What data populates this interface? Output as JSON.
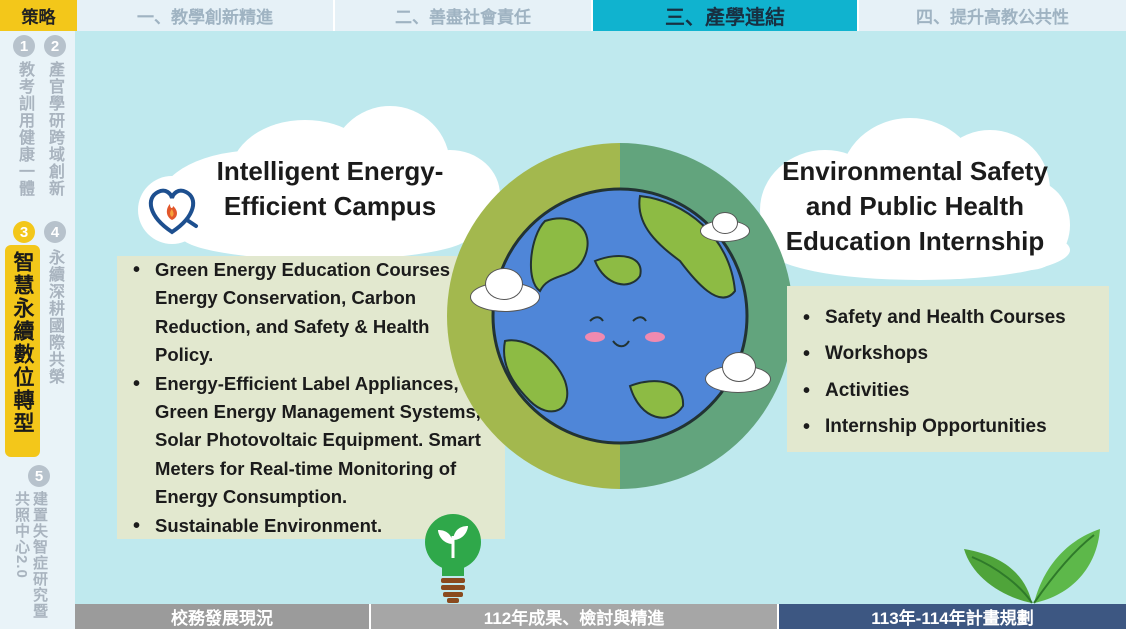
{
  "top_nav": {
    "strategy_label": "策略",
    "tabs": [
      {
        "label": "一、教學創新精進",
        "active": false
      },
      {
        "label": "二、善盡社會責任",
        "active": false
      },
      {
        "label": "三、產學連結",
        "active": true
      },
      {
        "label": "四、提升高教公共性",
        "active": false
      }
    ]
  },
  "sidebar": {
    "items": [
      {
        "number": "1",
        "label": "教考訓用健康一體"
      },
      {
        "number": "2",
        "label": "產官學研跨域創新"
      },
      {
        "number": "3",
        "label": "智慧永續數位轉型",
        "active": true
      },
      {
        "number": "4",
        "label": "永續深耕國際共榮"
      },
      {
        "number": "5",
        "label": "建置失智症研究暨共照中心2.0"
      }
    ]
  },
  "left_section": {
    "title_line1": "Intelligent Energy-",
    "title_line2": "Efficient Campus",
    "bullets": [
      {
        "lines": [
          "Green Energy Education Courses on",
          "Energy Conservation, Carbon",
          "Reduction, and Safety & Health",
          "Policy."
        ]
      },
      {
        "lines": [
          "Energy-Efficient Label Appliances,",
          "Green Energy Management Systems,",
          "Solar Photovoltaic Equipment. Smart",
          "Meters for Real-time Monitoring of",
          "Energy Consumption."
        ]
      },
      {
        "lines": [
          "Sustainable Environment."
        ]
      }
    ]
  },
  "right_section": {
    "title_line1": "Environmental Safety",
    "title_line2": "and Public Health",
    "title_line3": "Education Internship",
    "bullets": [
      "Safety and Health Courses",
      "Workshops",
      "Activities",
      "Internship Opportunities"
    ]
  },
  "bottom_nav": {
    "items": [
      "校務發展現況",
      "112年成果、檢討與精進",
      "113年-114年計畫規劃"
    ]
  },
  "icons": [
    "heart-plug-flame-icon",
    "earth-globe-icon",
    "lightbulb-sprout-icon",
    "leaves-icon",
    "cloud-icon"
  ],
  "colors": {
    "background": "#bfe9ee",
    "active_tab": "#10b3cf",
    "strategy_yellow": "#f3c71a",
    "panel": "#e2e8cf",
    "bottom_dark": "#3d5782"
  }
}
